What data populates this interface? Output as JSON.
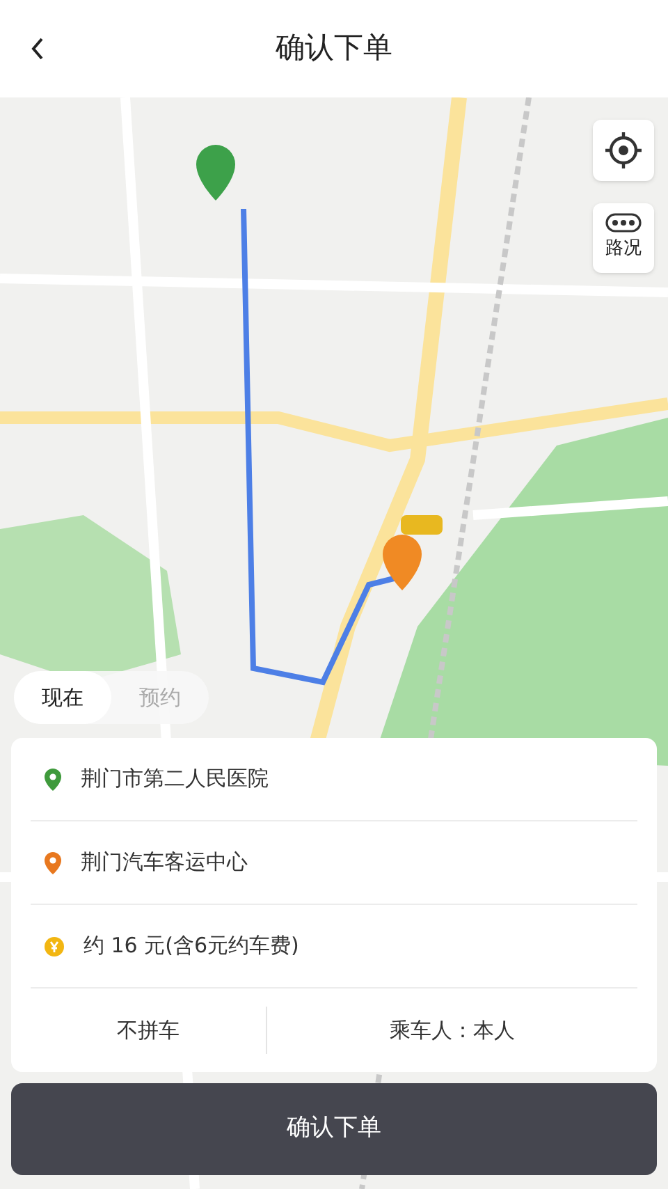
{
  "header": {
    "title": "确认下单"
  },
  "map": {
    "kind": "picture"
  },
  "traffic_button": {
    "label": "路况"
  },
  "mode_tabs": [
    {
      "label": "现在",
      "selected": true
    },
    {
      "label": "预约",
      "selected": false
    }
  ],
  "route": [
    {
      "kind": "origin",
      "text": "荆门市第二人民医院"
    },
    {
      "kind": "destination",
      "text": "荆门汽车客运中心"
    },
    {
      "kind": "fare",
      "text": "约 16 元(含6元约车费)"
    }
  ],
  "options": [
    "不拼车",
    "乘车人：本人"
  ],
  "confirm_button": {
    "label": "确认下单"
  }
}
